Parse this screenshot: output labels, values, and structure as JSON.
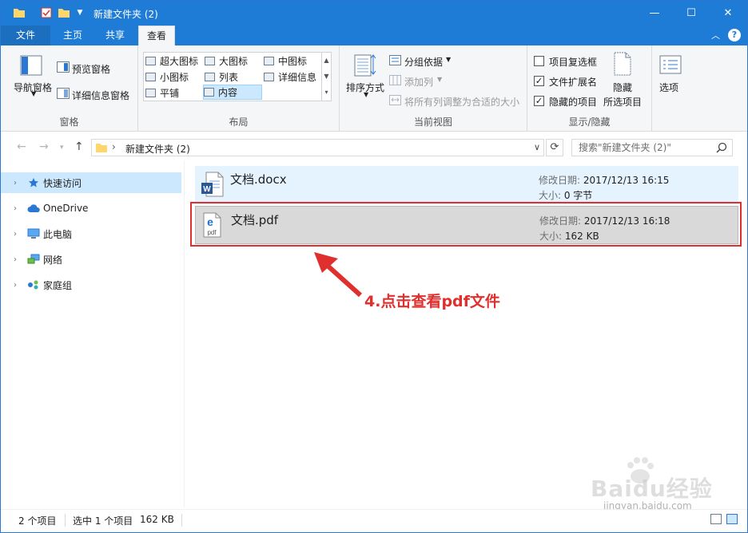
{
  "window": {
    "title": "新建文件夹 (2)"
  },
  "tabs": {
    "file": "文件",
    "home": "主页",
    "share": "共享",
    "view": "查看"
  },
  "ribbon": {
    "panes": {
      "nav_pane": "导航窗格",
      "preview_pane": "预览窗格",
      "details_pane": "详细信息窗格",
      "label": "窗格"
    },
    "layout": {
      "extra_large": "超大图标",
      "large": "大图标",
      "medium": "中图标",
      "small": "小图标",
      "list": "列表",
      "details": "详细信息",
      "tiles": "平铺",
      "content": "内容",
      "label": "布局"
    },
    "current_view": {
      "sort": "排序方式",
      "group_by": "分组依据",
      "add_column": "添加列",
      "size_columns": "将所有列调整为合适的大小",
      "label": "当前视图"
    },
    "show_hide": {
      "item_checkboxes": "项目复选框",
      "file_extensions": "文件扩展名",
      "hidden_items": "隐藏的项目",
      "hide_selected_1": "隐藏",
      "hide_selected_2": "所选项目",
      "label": "显示/隐藏",
      "item_checkboxes_checked": false,
      "file_extensions_checked": true,
      "hidden_items_checked": true
    },
    "options": "选项"
  },
  "address": {
    "crumb": "新建文件夹 (2)",
    "search_placeholder": "搜索\"新建文件夹 (2)\""
  },
  "nav": {
    "items": [
      {
        "label": "快速访问",
        "icon": "star-icon"
      },
      {
        "label": "OneDrive",
        "icon": "cloud-icon"
      },
      {
        "label": "此电脑",
        "icon": "computer-icon"
      },
      {
        "label": "网络",
        "icon": "network-icon"
      },
      {
        "label": "家庭组",
        "icon": "homegroup-icon"
      }
    ]
  },
  "files": [
    {
      "name": "文档.docx",
      "date_label": "修改日期: ",
      "date": "2017/12/13 16:15",
      "size_label": "大小: ",
      "size": "0 字节",
      "icon": "word-doc-icon"
    },
    {
      "name": "文档.pdf",
      "date_label": "修改日期: ",
      "date": "2017/12/13 16:18",
      "size_label": "大小: ",
      "size": "162 KB",
      "icon": "pdf-icon"
    }
  ],
  "annotation": "4.点击查看pdf文件",
  "status": {
    "count": "2 个项目",
    "selected": "选中 1 个项目",
    "size": "162 KB"
  },
  "watermark": {
    "text": "Baidu经验",
    "url": "jingyan.baidu.com"
  },
  "colors": {
    "accent": "#1f7cd6",
    "selection": "#cce8ff",
    "annotation": "#e0302e"
  }
}
